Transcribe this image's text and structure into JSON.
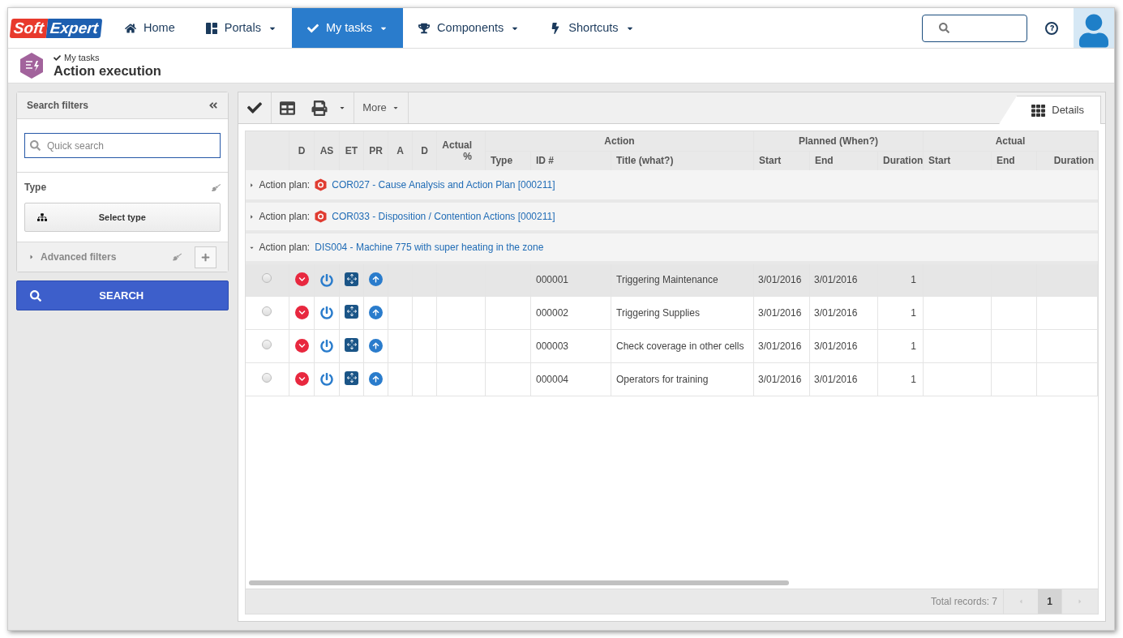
{
  "logo": {
    "part1": "Soft",
    "part2": "Expert"
  },
  "nav": [
    {
      "label": "Home",
      "dropdown": false,
      "selected": false
    },
    {
      "label": "Portals",
      "dropdown": true,
      "selected": false
    },
    {
      "label": "My tasks",
      "dropdown": true,
      "selected": true
    },
    {
      "label": "Components",
      "dropdown": true,
      "selected": false
    },
    {
      "label": "Shortcuts",
      "dropdown": true,
      "selected": false
    }
  ],
  "header": {
    "breadcrumb": "My tasks",
    "title": "Action execution"
  },
  "filters": {
    "title": "Search filters",
    "quick_search": {
      "placeholder": "Quick search"
    },
    "type_label": "Type",
    "select_type": "Select type",
    "advanced": "Advanced filters",
    "advanced_expanded": false,
    "search_button": "SEARCH"
  },
  "toolbar": {
    "more": "More",
    "tab": "Details"
  },
  "table": {
    "top_columns": [
      "D",
      "AS",
      "ET",
      "PR",
      "A",
      "D"
    ],
    "actual_pct": "Actual %",
    "groups": [
      {
        "title": "Action",
        "columns": [
          "Type",
          "ID #",
          "Title (what?)"
        ]
      },
      {
        "title": "Planned (When?)",
        "columns": [
          "Start",
          "End",
          "Duration"
        ]
      },
      {
        "title": "Actual",
        "columns": [
          "Start",
          "End",
          "Duration"
        ]
      }
    ],
    "plans": [
      {
        "label": "Action plan:",
        "name": "COR027 - Cause Analysis and Action Plan [000211]",
        "warning": true,
        "expanded": false
      },
      {
        "label": "Action plan:",
        "name": "COR033 - Disposition / Contention Actions [000211]",
        "warning": true,
        "expanded": false
      },
      {
        "label": "Action plan:",
        "name": "DIS004 - Machine 775 with super heating in the zone",
        "warning": false,
        "expanded": true,
        "rows": [
          {
            "id": "000001",
            "title": "Triggering Maintenance",
            "start": "3/01/2016",
            "end": "3/01/2016",
            "duration": "1",
            "selected": true
          },
          {
            "id": "000002",
            "title": "Triggering Supplies",
            "start": "3/01/2016",
            "end": "3/01/2016",
            "duration": "1",
            "selected": false
          },
          {
            "id": "000003",
            "title": "Check coverage in other cells",
            "start": "3/01/2016",
            "end": "3/01/2016",
            "duration": "1",
            "selected": false
          },
          {
            "id": "000004",
            "title": "Operators for training",
            "start": "3/01/2016",
            "end": "3/01/2016",
            "duration": "1",
            "selected": false
          }
        ]
      }
    ]
  },
  "footer": {
    "total": "Total records: 7",
    "pages": [
      {
        "label": "1",
        "selected": true
      }
    ]
  }
}
